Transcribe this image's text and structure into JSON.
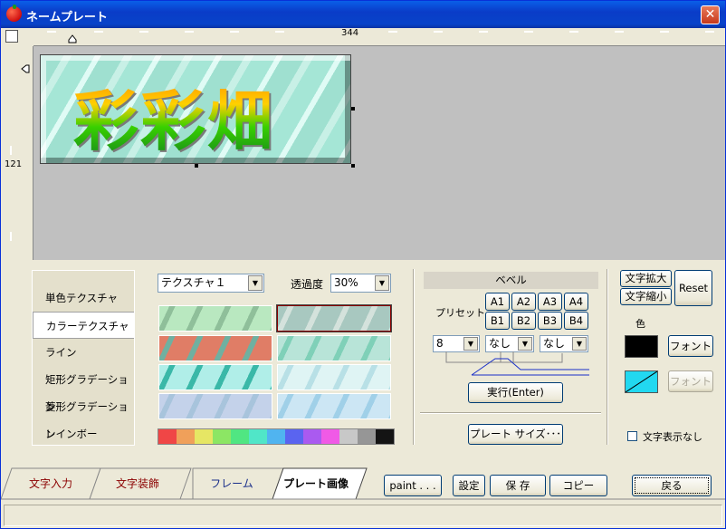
{
  "window": {
    "title": "ネームプレート",
    "close_glyph": "✕",
    "app_icon": "tomato-icon"
  },
  "rulers": {
    "top_value": "344",
    "left_value": "121"
  },
  "plate": {
    "text": "彩彩畑"
  },
  "categories": [
    {
      "label": "単色テクスチャ"
    },
    {
      "label": "カラーテクスチャ"
    },
    {
      "label": "ライン"
    },
    {
      "label": "矩形グラデーション"
    },
    {
      "label": "菱形グラデーション"
    },
    {
      "label": "レインボー"
    }
  ],
  "texture": {
    "selected": "テクスチャ１",
    "opacity_label": "透過度",
    "opacity_value": "30%"
  },
  "textures": [
    {
      "a": "#b9e8c0",
      "b": "#8fbf9a"
    },
    {
      "a": "#a8c8c0",
      "b": "#d4e2dc"
    },
    {
      "a": "#e07d66",
      "b": "#6fb0a0"
    },
    {
      "a": "#b8e4d8",
      "b": "#7fd0b8"
    },
    {
      "a": "#b0eee8",
      "b": "#3ab8a8"
    },
    {
      "a": "#dff4f4",
      "b": "#b8e0e6"
    },
    {
      "a": "#c4d2ea",
      "b": "#a8c4dc"
    },
    {
      "a": "#cce6f4",
      "b": "#a0d0e8"
    }
  ],
  "palette": [
    "#f04646",
    "#f0a05a",
    "#e6e664",
    "#8ce664",
    "#50e682",
    "#50e6c8",
    "#50b4f0",
    "#5a64f0",
    "#aa5af0",
    "#f05ae6",
    "#c8c8c8",
    "#969696",
    "#141414"
  ],
  "bevel": {
    "header": "ベベル",
    "preset_label": "プリセット",
    "presets": [
      "A1",
      "A2",
      "A3",
      "A4",
      "B1",
      "B2",
      "B3",
      "B4"
    ],
    "size_value": "8",
    "style1_value": "なし",
    "style2_value": "なし",
    "execute_label": "実行(Enter)"
  },
  "plate_size_label": "プレート サイズ･･･",
  "text_controls": {
    "enlarge_label": "文字拡大",
    "shrink_label": "文字縮小",
    "reset_label": "Reset",
    "color_label": "色",
    "color1": "#000000",
    "color2": "#22d8f0",
    "font1_label": "フォント",
    "font2_label": "フォント",
    "hide_text_label": "文字表示なし"
  },
  "actions": {
    "paint": "paint . . .",
    "settings": "設定",
    "save": "保 存",
    "copy": "コピー",
    "back": "戻る"
  },
  "tabs": [
    {
      "label": "文字入力"
    },
    {
      "label": "文字装飾"
    },
    {
      "label": "フレーム"
    },
    {
      "label": "プレート画像"
    }
  ]
}
